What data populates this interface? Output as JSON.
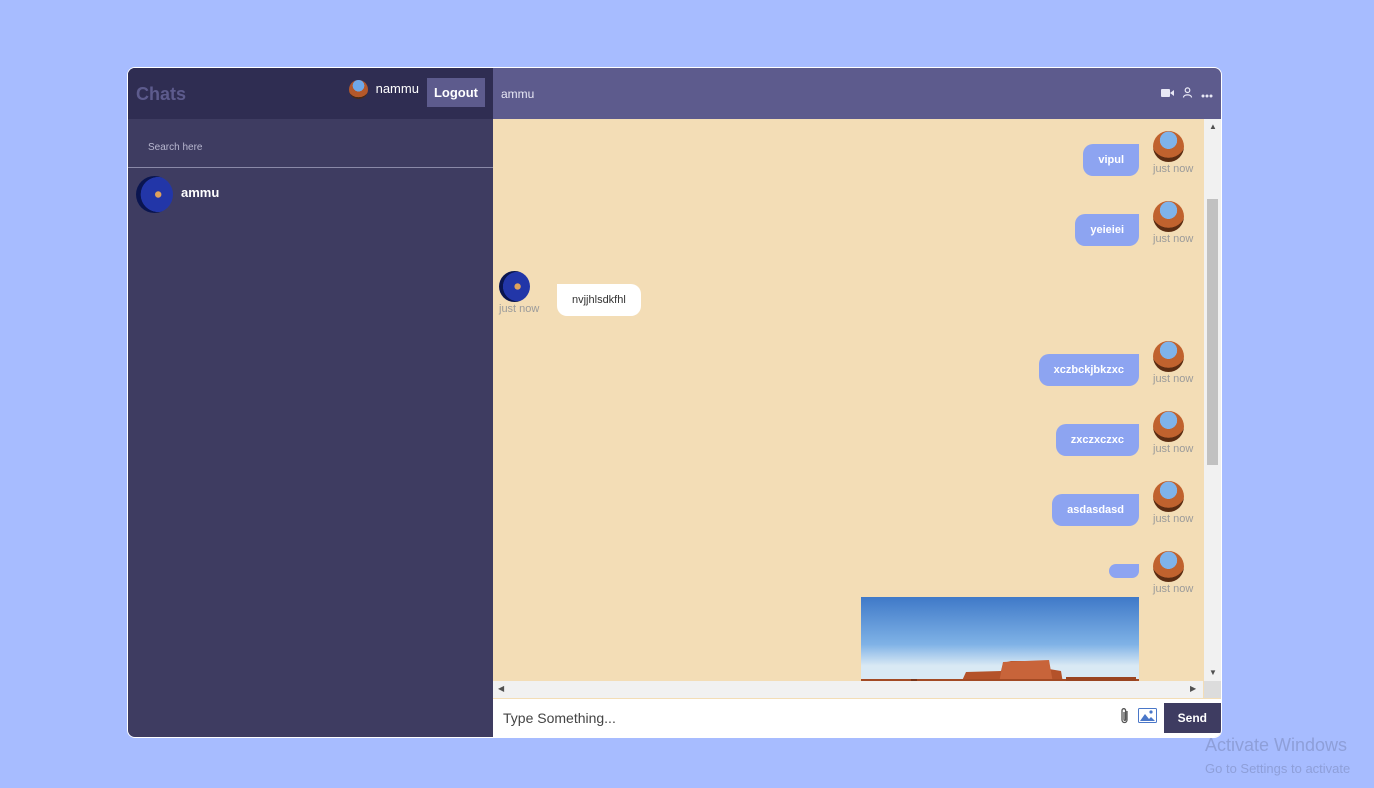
{
  "sidebar": {
    "logo": "Chats",
    "current_user": "nammu",
    "logout_label": "Logout",
    "search_placeholder": "Search here",
    "chats": [
      {
        "name": "ammu"
      }
    ]
  },
  "chat": {
    "title": "ammu",
    "icons": [
      "video-camera-icon",
      "add-user-icon",
      "more-icon"
    ],
    "messages": [
      {
        "owner": "me",
        "text": "vipul",
        "time": "just now"
      },
      {
        "owner": "me",
        "text": "yeieiei",
        "time": "just now"
      },
      {
        "owner": "other",
        "text": "nvjjhlsdkfhl",
        "time": "just now"
      },
      {
        "owner": "me",
        "text": "xczbckjbkzxc",
        "time": "just now"
      },
      {
        "owner": "me",
        "text": "zxczxczxc",
        "time": "just now"
      },
      {
        "owner": "me",
        "text": "asdasdasd",
        "time": "just now"
      },
      {
        "owner": "me",
        "text": "",
        "time": "just now"
      }
    ],
    "input_placeholder": "Type Something...",
    "send_label": "Send"
  },
  "watermark": {
    "title": "Activate Windows",
    "subtitle": "Go to Settings to activate"
  },
  "colors": {
    "background": "#a7bcff",
    "sidebar": "#3e3c61",
    "navbar": "#2f2d52",
    "chat_header": "#5d5b8d",
    "chat_bg": "#f3ddb6",
    "own_bubble": "#8da4f1"
  }
}
